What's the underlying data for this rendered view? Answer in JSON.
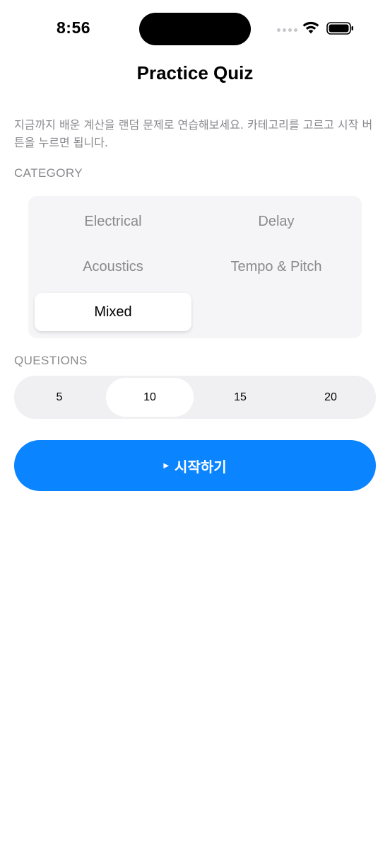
{
  "status": {
    "time": "8:56",
    "icons": [
      "signal-dots-icon",
      "wifi-icon",
      "battery-icon"
    ]
  },
  "nav": {
    "title": "Practice Quiz"
  },
  "description": "지금까지 배운 계산을 랜덤 문제로 연습해보세요. 카테고리를 고르고 시작 버튼을 누르면 됩니다.",
  "category": {
    "label": "CATEGORY",
    "items": [
      {
        "label": "Electrical"
      },
      {
        "label": "Delay"
      },
      {
        "label": "Acoustics"
      },
      {
        "label": "Tempo & Pitch"
      },
      {
        "label": "Mixed"
      }
    ],
    "selected": "Mixed"
  },
  "questions": {
    "label": "QUESTIONS",
    "options": [
      "5",
      "10",
      "15",
      "20"
    ],
    "selected": "10"
  },
  "start_button": {
    "icon": "play-icon",
    "label": "시작하기"
  },
  "colors": {
    "accent": "#0a84ff",
    "secondary_text": "#8a8a8e",
    "group_bg": "#f5f5f7"
  }
}
